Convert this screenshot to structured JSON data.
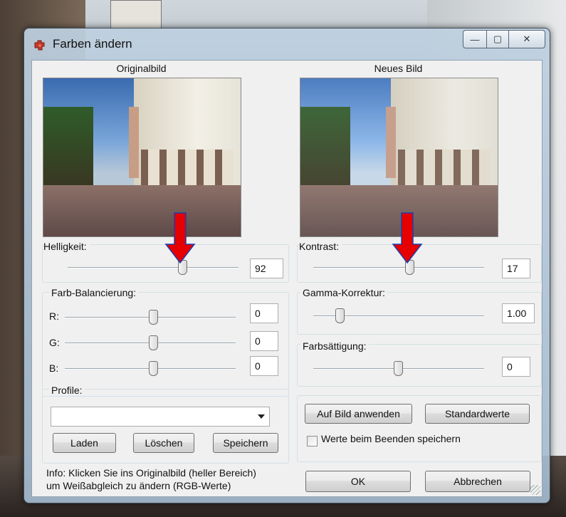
{
  "window": {
    "title": "Farben ändern",
    "controls": {
      "minimize": "—",
      "maximize": "▢",
      "close": "✕"
    }
  },
  "images": {
    "original_caption": "Originalbild",
    "new_caption": "Neues Bild"
  },
  "brightness": {
    "label": "Helligkeit:",
    "value": "92",
    "slider_fraction": 0.67
  },
  "contrast": {
    "label": "Kontrast:",
    "value": "17",
    "slider_fraction": 0.55
  },
  "color_balance": {
    "label": "Farb-Balancierung:",
    "channels": [
      {
        "label": "R:",
        "value": "0",
        "slider_fraction": 0.5
      },
      {
        "label": "G:",
        "value": "0",
        "slider_fraction": 0.5
      },
      {
        "label": "B:",
        "value": "0",
        "slider_fraction": 0.5
      }
    ]
  },
  "gamma": {
    "label": "Gamma-Korrektur:",
    "value": "1.00",
    "slider_fraction": 0.12
  },
  "saturation": {
    "label": "Farbsättigung:",
    "value": "0",
    "slider_fraction": 0.5
  },
  "profiles": {
    "label": "Profile:",
    "selected": "",
    "load_label": "Laden",
    "delete_label": "Löschen",
    "save_label": "Speichern"
  },
  "actions": {
    "apply_label": "Auf Bild anwenden",
    "defaults_label": "Standardwerte",
    "save_on_exit_label": "Werte beim Beenden speichern",
    "ok_label": "OK",
    "cancel_label": "Abbrechen"
  },
  "info": {
    "line1": "Info: Klicken Sie ins Originalbild (heller Bereich)",
    "line2": "um Weißabgleich zu ändern (RGB-Werte)"
  },
  "colors": {
    "annotation_arrow": "#e60000",
    "arrow_outline": "#1a3fb0"
  }
}
